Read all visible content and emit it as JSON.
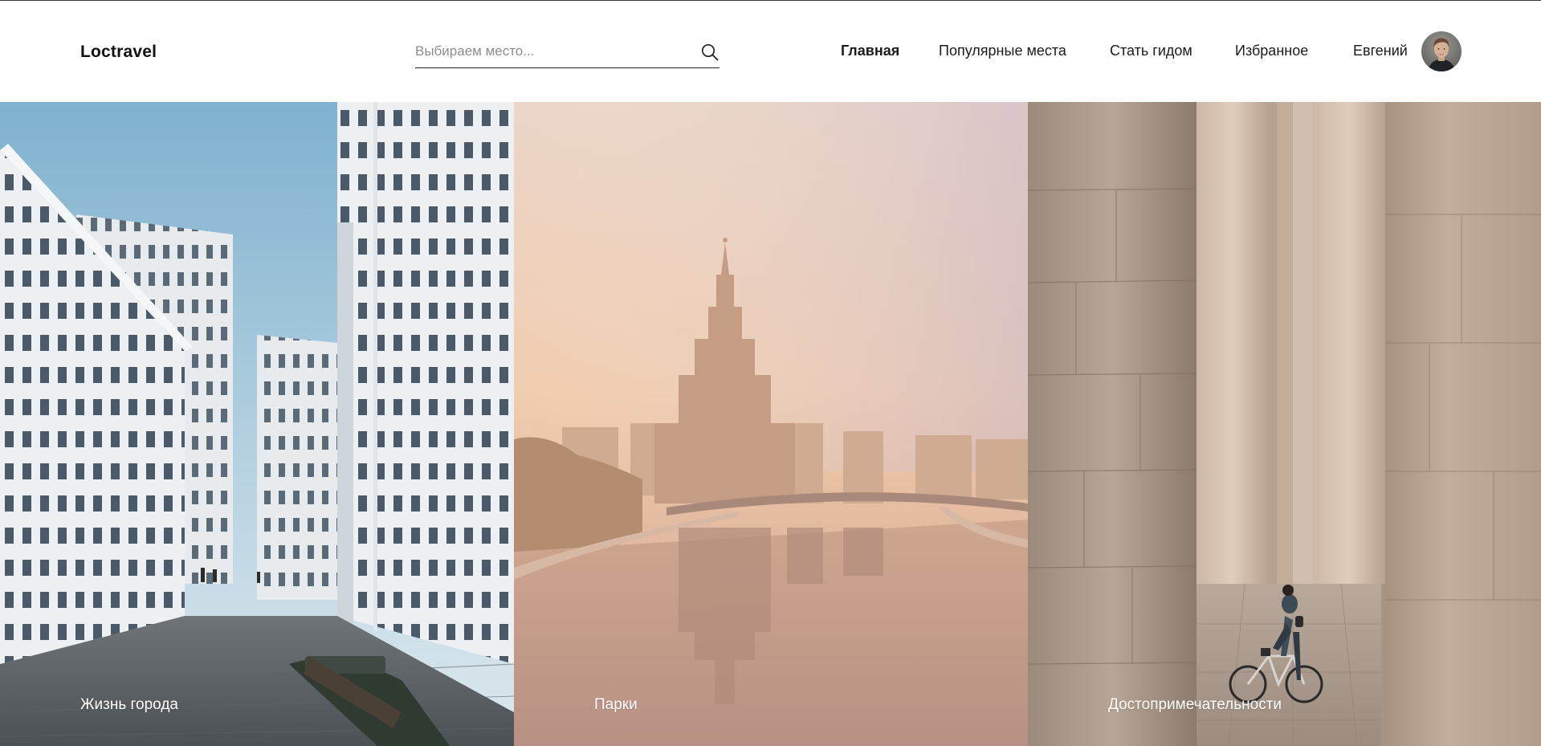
{
  "header": {
    "logo": "Loctravel",
    "search": {
      "placeholder": "Выбираем место..."
    },
    "nav": [
      {
        "label": "Главная",
        "active": true
      },
      {
        "label": "Популярные места",
        "active": false
      },
      {
        "label": "Стать гидом",
        "active": false
      },
      {
        "label": "Избранное",
        "active": false
      }
    ],
    "user": {
      "name": "Евгений",
      "avatar_icon": "user-avatar"
    }
  },
  "panels": [
    {
      "caption": "Жизнь города",
      "image": "city-buildings-photo"
    },
    {
      "caption": "Парки",
      "image": "river-skyscraper-photo"
    },
    {
      "caption": "Достопримечательности",
      "image": "columns-cyclist-photo"
    }
  ],
  "icons": {
    "search": "search-icon"
  },
  "colors": {
    "text": "#111111",
    "caption": "#ffffff",
    "background": "#ffffff"
  }
}
